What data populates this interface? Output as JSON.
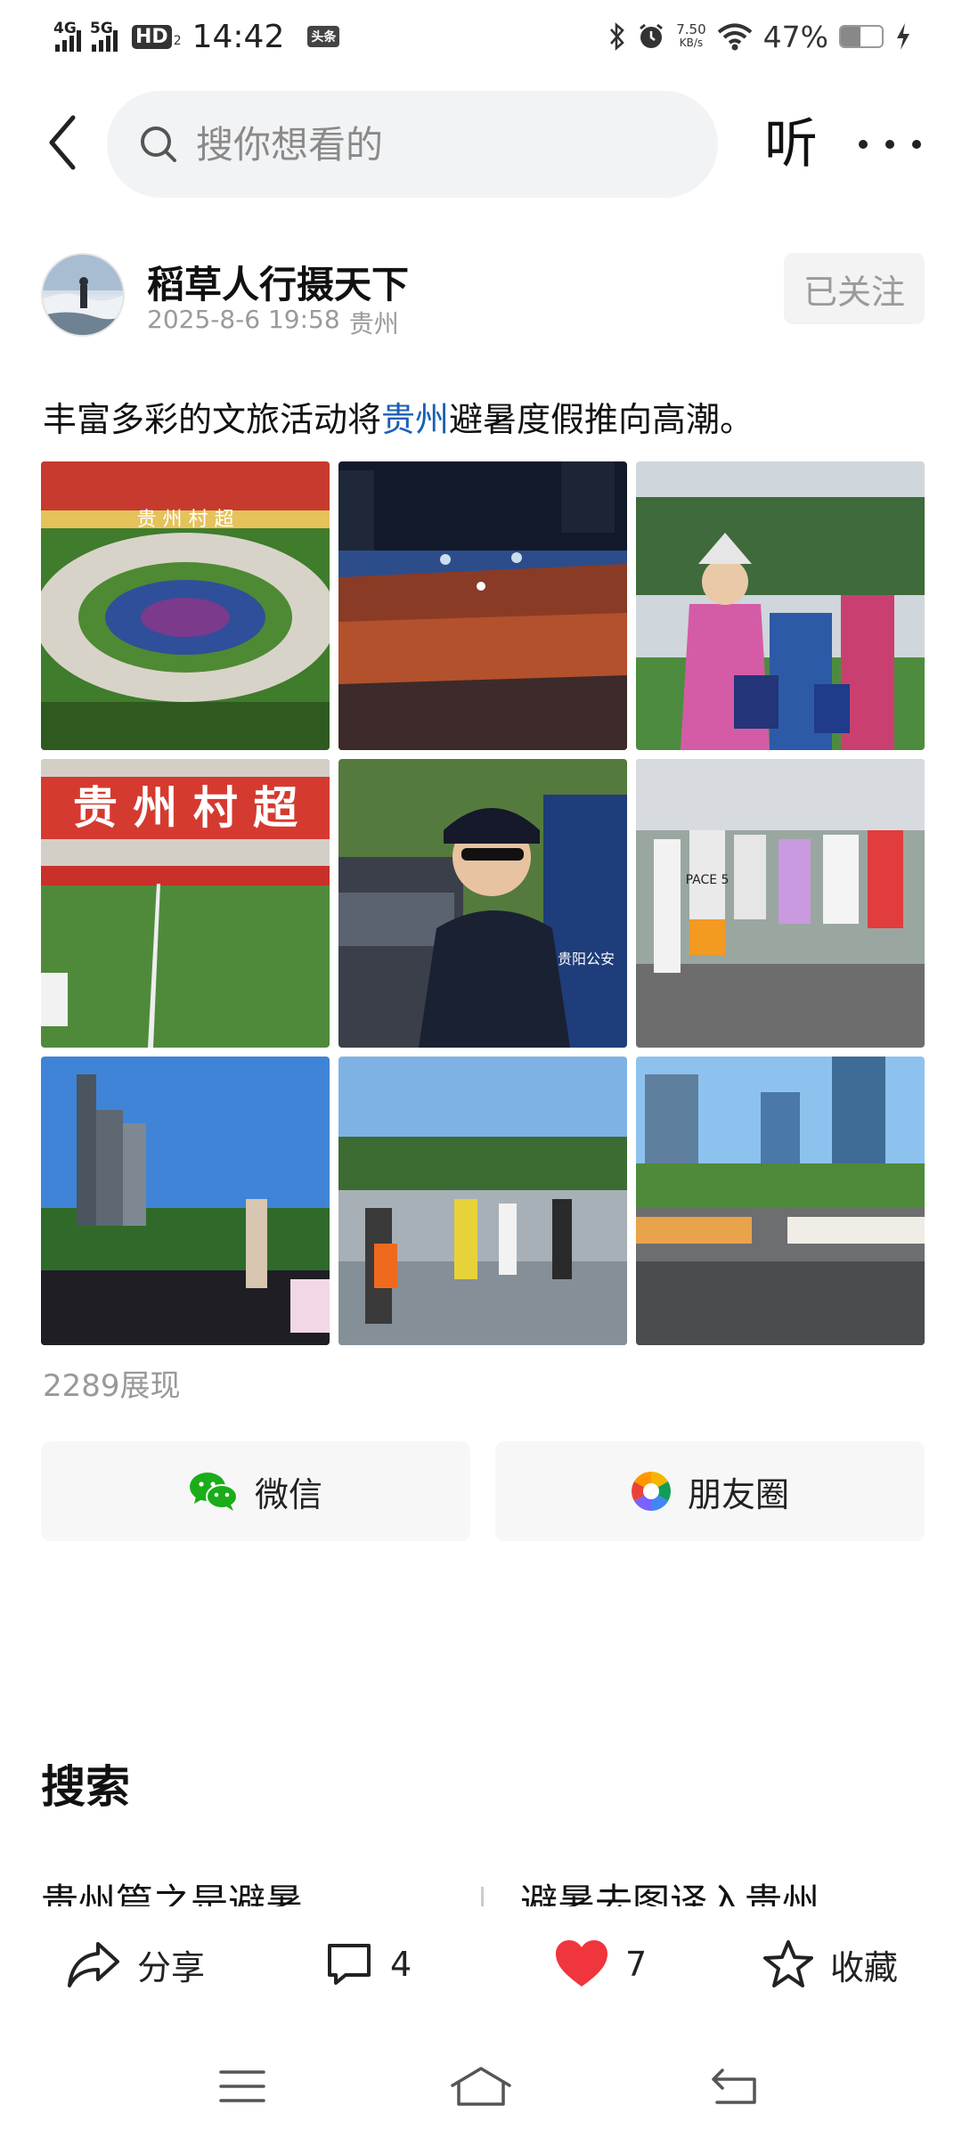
{
  "status_bar": {
    "network_1": "4G",
    "network_2": "5G",
    "hd_badge": "HD",
    "hd_sub": "2",
    "time": "14:42",
    "app_badge": "头条",
    "speed_value": "7.50",
    "speed_unit": "KB/s",
    "battery": "47%",
    "battery_level": 0.47
  },
  "header": {
    "search_placeholder": "搜你想看的",
    "listen_label": "听"
  },
  "author": {
    "name": "稻草人行摄天下",
    "date": "2025-8-6 19:58",
    "location": "贵州",
    "follow_label": "已关注"
  },
  "post": {
    "text_before": "丰富多彩的文旅活动将",
    "link_text": "贵州",
    "text_after": "避暑度假推向高潮。",
    "views": "2289展现",
    "images": [
      {
        "overlay": "贵 州 村 超"
      },
      {
        "overlay": ""
      },
      {
        "overlay": ""
      },
      {
        "overlay": "贵 州 村 超"
      },
      {
        "overlay": "贵阳公安"
      },
      {
        "overlay": "PACE 5"
      },
      {
        "overlay": ""
      },
      {
        "overlay": ""
      },
      {
        "overlay": ""
      }
    ]
  },
  "share": {
    "wechat_label": "微信",
    "moments_label": "朋友圈"
  },
  "search_section": {
    "title": "搜索",
    "suggestion_1": "贵州篇之是避暑",
    "suggestion_2": "避暑去图译入贵州"
  },
  "actions": {
    "share_label": "分享",
    "comment_count": "4",
    "like_count": "7",
    "favorite_label": "收藏"
  },
  "colors": {
    "accent_link": "#1a5fb4",
    "like_red": "#f0353c",
    "wechat_green": "#1aad19"
  }
}
